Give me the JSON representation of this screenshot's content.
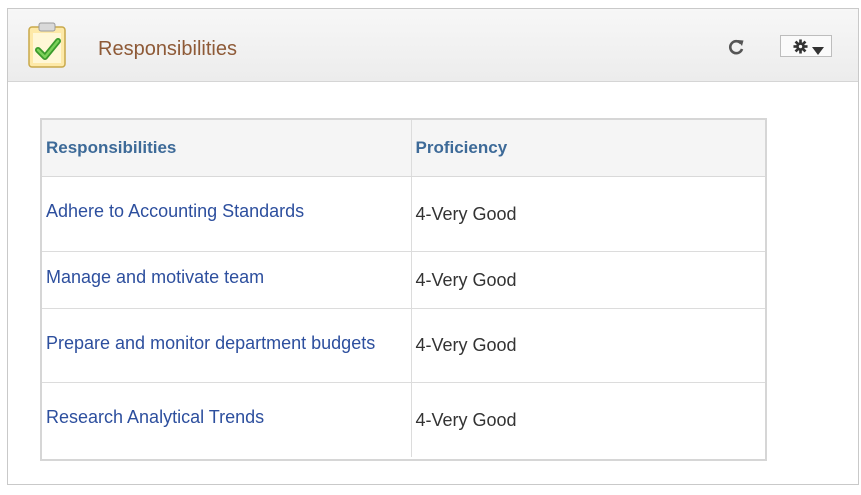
{
  "header": {
    "title": "Responsibilities",
    "icon": "clipboard-check-icon",
    "refresh_icon": "refresh-icon",
    "settings_icon": "gear-icon",
    "caret_icon": "caret-down-icon",
    "title_color": "#8e5a37"
  },
  "table": {
    "columns": [
      "Responsibilities",
      "Proficiency"
    ],
    "rows": [
      {
        "responsibility": "Adhere to Accounting Standards",
        "proficiency": "4-Very Good"
      },
      {
        "responsibility": "Manage and motivate team",
        "proficiency": "4-Very Good"
      },
      {
        "responsibility": "Prepare and monitor department budgets",
        "proficiency": "4-Very Good"
      },
      {
        "responsibility": "Research Analytical Trends",
        "proficiency": "4-Very Good"
      }
    ],
    "link_color": "#2d4f9e",
    "header_color": "#3d6a98"
  }
}
